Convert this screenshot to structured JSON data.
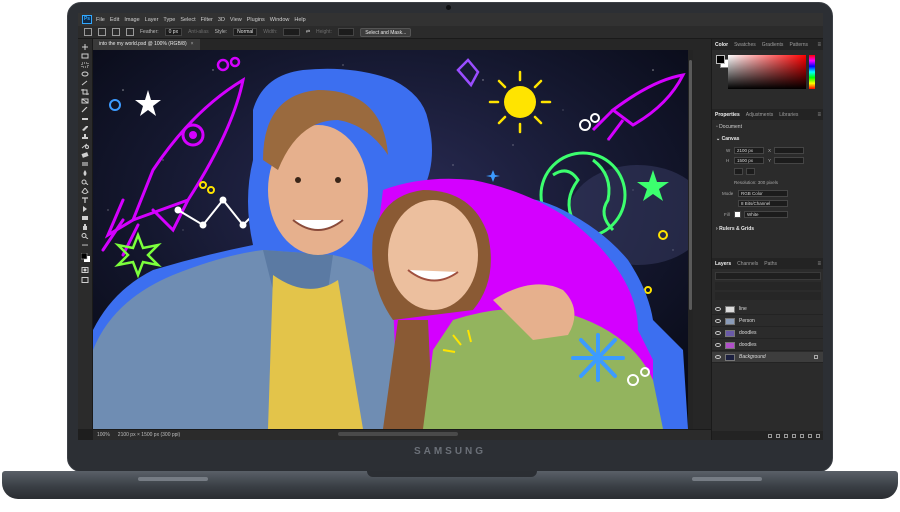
{
  "menubar": {
    "logo": "Ps",
    "items": [
      "File",
      "Edit",
      "Image",
      "Layer",
      "Type",
      "Select",
      "Filter",
      "3D",
      "View",
      "Plugins",
      "Window",
      "Help"
    ]
  },
  "options_bar": {
    "feather_label": "Feather:",
    "feather_value": "0 px",
    "anti_alias": "Anti-alias",
    "style_label": "Style:",
    "style_value": "Normal",
    "width_label": "Width:",
    "height_label": "Height:",
    "select_mask_button": "Select and Mask..."
  },
  "document": {
    "tab_title": "into the my world.psd @ 100% (RGB/8)",
    "tab_close": "×"
  },
  "statusbar": {
    "zoom": "100%",
    "doc_info": "2100 px × 1500 px (300 ppi)"
  },
  "color_panel": {
    "tabs": [
      "Color",
      "Swatches",
      "Gradients",
      "Patterns"
    ]
  },
  "properties_panel": {
    "tabs": [
      "Properties",
      "Adjustments",
      "Libraries"
    ],
    "doc_label": "Document",
    "canvas_section": "Canvas",
    "width_label": "W",
    "width_value": "2100 px",
    "height_label": "H",
    "height_value": "1500 px",
    "resolution": "Resolution: 300 pixels",
    "mode_label": "Mode",
    "mode_value": "RGB Color",
    "depth_value": "8 Bits/Channel",
    "fill_label": "Fill",
    "fill_value": "White",
    "rulers_section": "Rulers & Grids"
  },
  "layers_panel": {
    "tabs": [
      "Layers",
      "Channels",
      "Paths"
    ],
    "layers": [
      {
        "name": "line"
      },
      {
        "name": "Person"
      },
      {
        "name": "doodles"
      },
      {
        "name": "doodles"
      },
      {
        "name": "Background"
      }
    ]
  },
  "hardware": {
    "brand": "SAMSUNG"
  },
  "colors": {
    "ps_dark": "#2b2b2b",
    "ps_blue": "#31a8ff",
    "neon_pink": "#d400ff",
    "neon_blue": "#3c6ff0",
    "neon_yellow": "#ffe400"
  }
}
